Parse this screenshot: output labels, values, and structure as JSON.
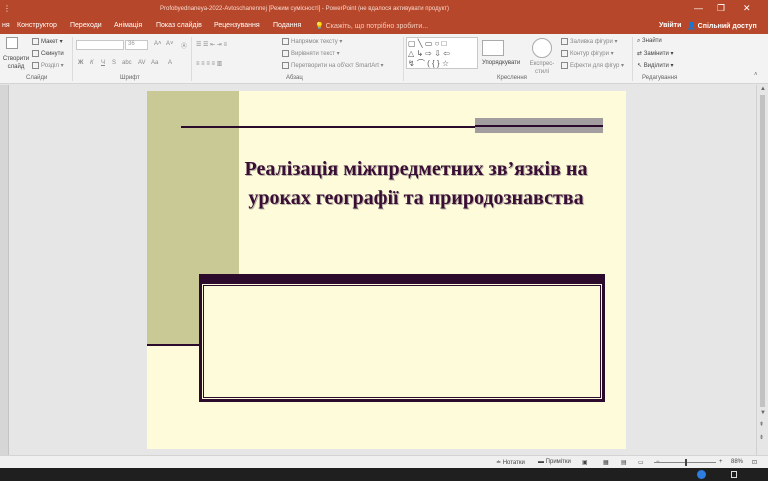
{
  "window": {
    "title": "Profobyednaneya-2022-Avtoschanennej [Режим сумісності] - PowerPoint (не вдалося активувати продукт)",
    "minimize": "—",
    "restore": "❐",
    "close": "✕"
  },
  "tabs": [
    "ня",
    "Конструктор",
    "Переходи",
    "Анімація",
    "Показ слайдів",
    "Рецензування",
    "Подання"
  ],
  "tell_me": "Скажіть, що потрібно зробити...",
  "account": {
    "signin": "Увійти",
    "share": "Спільний доступ"
  },
  "ribbon": {
    "slides": {
      "new_slide": "Створити слайд",
      "layout": "Макет",
      "reset": "Скинути",
      "section": "Розділ",
      "label": "Слайди"
    },
    "font": {
      "font_name": "",
      "font_size": "36",
      "bold": "Ж",
      "italic": "К",
      "underline": "Ч",
      "strike": "S",
      "label": "Шрифт"
    },
    "paragraph": {
      "text_direction": "Напрямок тексту",
      "align_text": "Вирівняти текст",
      "smartart": "Перетворити на об'єкт SmartArt",
      "label": "Абзац"
    },
    "drawing": {
      "arrange": "Упорядкувати",
      "quick_styles": "Експрес-стилі",
      "fill": "Заливка фігури",
      "outline": "Контур фігури",
      "effects": "Ефекти для фігур",
      "label": "Креслення"
    },
    "editing": {
      "find": "Знайти",
      "replace": "Замінити",
      "select": "Виділити",
      "label": "Редагування"
    }
  },
  "slide": {
    "title": "Реалізація міжпредметних зв’язків на уроках географії та природознавства"
  },
  "statusbar": {
    "notes": "Нотатки",
    "comments": "Примітки",
    "zoom": "88%"
  },
  "colors": {
    "ribbon_accent": "#b7472a",
    "slide_background": "#fdfbd9",
    "slide_olive": "#c9c996",
    "slide_dark": "#2b0a2b",
    "title_color": "#3a0d34"
  }
}
